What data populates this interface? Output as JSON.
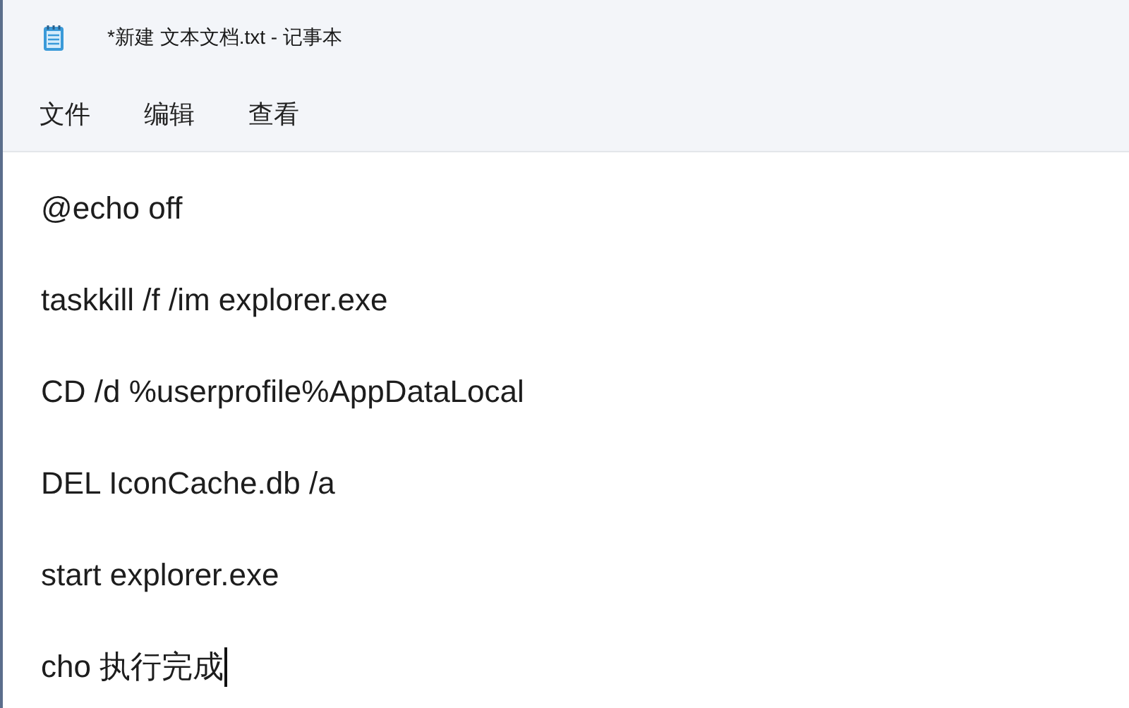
{
  "window": {
    "title": "*新建 文本文档.txt - 记事本"
  },
  "menu": [
    {
      "label": "文件"
    },
    {
      "label": "编辑"
    },
    {
      "label": "查看"
    }
  ],
  "editor": {
    "lines": [
      {
        "text": "@echo off",
        "caret": false
      },
      {
        "text": "taskkill /f /im explorer.exe",
        "caret": false
      },
      {
        "text": "CD /d %userprofile%AppDataLocal",
        "caret": false
      },
      {
        "text": "DEL IconCache.db /a",
        "caret": false
      },
      {
        "text": "start explorer.exe",
        "caret": false
      },
      {
        "text": "cho 执行完成",
        "caret": true
      }
    ]
  }
}
